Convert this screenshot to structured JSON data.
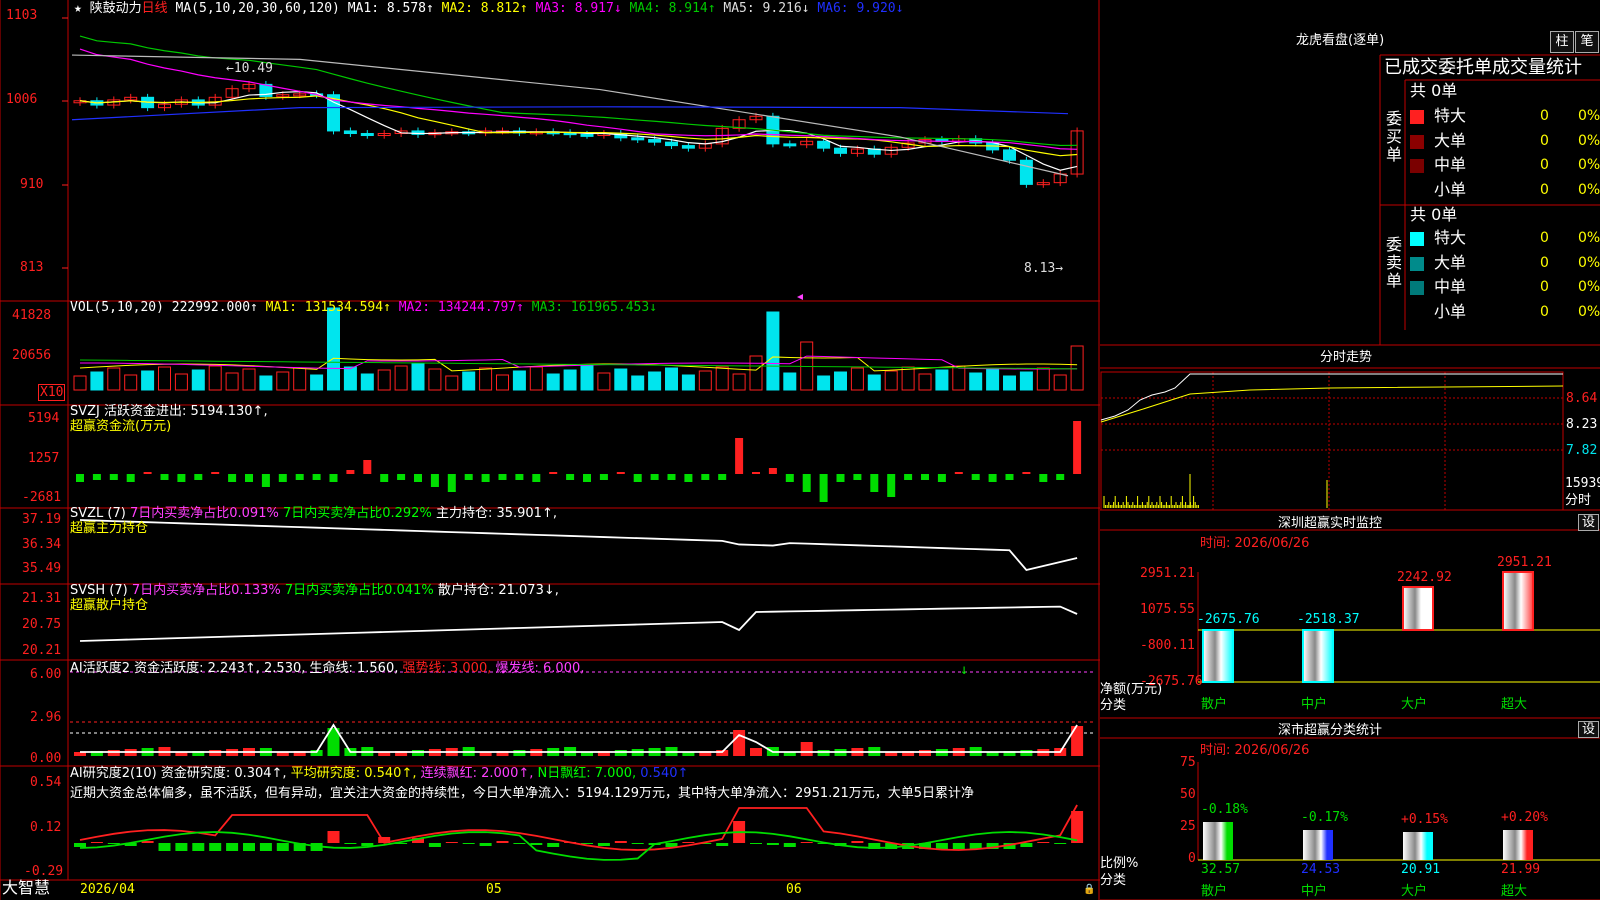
{
  "colors": {
    "up": "#ff2020",
    "down": "#00e5ee",
    "grid": "#c00000",
    "ma1": "#ffffff",
    "ma2": "#ffff00",
    "ma3": "#ff00ff",
    "ma4": "#00c800",
    "ma5": "#bbbbbb",
    "ma6": "#2030ff",
    "green": "#00dd00",
    "yellow": "#ffff00",
    "magenta": "#ff40ff",
    "cyan": "#00ffff"
  },
  "main": {
    "ystar": "★",
    "stock_name": "陕鼓动力",
    "period": "日线",
    "ma_label": "MA(5,10,20,30,60,120)",
    "ma1": "MA1: 8.578↑",
    "ma2": "MA2: 8.812↑",
    "ma3": "MA3: 8.917↓",
    "ma4": "MA4: 8.914↑",
    "ma5": "MA5: 9.216↓",
    "ma6": "MA6: 9.920↓",
    "yticks": [
      "1103",
      "1006",
      "910",
      "813"
    ],
    "high_mark": "←10.49",
    "low_mark": "8.13→"
  },
  "vol": {
    "label": "VOL(5,10,20)",
    "value": "222992.000↑",
    "ma1": "MA1: 131534.594↑",
    "ma2": "MA2: 134244.797↑",
    "ma3": "MA3: 161965.453↓",
    "yticks": [
      "41828",
      "20656"
    ],
    "unit": "X10"
  },
  "svzj": {
    "label": "SVZJ  活跃资金进出: 5194.130↑,",
    "sub": "超赢资金流(万元)",
    "yticks": [
      "5194",
      "1257",
      "-2681"
    ]
  },
  "svzl": {
    "label": "SVZL (7)",
    "t1": "7日内买卖净占比0.091%",
    "t2": "7日内买卖净占比0.292%",
    "t3": "主力持仓: 35.901↑,",
    "sub": "超赢主力持仓",
    "yticks": [
      "37.19",
      "36.34",
      "35.49"
    ]
  },
  "svsh": {
    "label": "SVSH (7)",
    "t1": "7日内买卖净占比0.133%",
    "t2": "7日内买卖净占比0.041%",
    "t3": "散户持仓: 21.073↓,",
    "sub": "超赢散户持仓",
    "yticks": [
      "21.31",
      "20.75",
      "20.21"
    ]
  },
  "ai2": {
    "label": "AI活跃度2 资金活跃度: 2.243↑, 2.530, 生命线: 1.560,",
    "t1": "强势线: 3.000,",
    "t2": "爆发线: 6.000,",
    "yticks": [
      "6.00",
      "2.96",
      "0.00"
    ]
  },
  "air": {
    "label": "AI研究度2(10) 资金研究度: 0.304↑,",
    "t1": "平均研究度: 0.540↑,",
    "t2": "连续飘红: 2.000↑,",
    "t3": "N日飘红: 7.000,",
    "t4": "0.540↑",
    "desc": "近期大资金总体偏多，虽不活跃，但有异动，宜关注大资金的持续性，今日大单净流入：5194.129万元，其中特大单净流入：2951.21万元，大单5日累计净",
    "yticks": [
      "0.54",
      "0.12",
      "-0.29"
    ]
  },
  "bottom": {
    "logo": "大智慧",
    "dates": [
      "2026/04",
      "05",
      "06"
    ]
  },
  "right": {
    "title": "龙虎看盘(逐单)",
    "btn1": "柱",
    "btn2": "笔",
    "header": "已成交委托单成交量统计",
    "buy": {
      "side": "委买单",
      "total": "共 0单",
      "rows": [
        {
          "name": "特大",
          "val": "0",
          "pct": "0%"
        },
        {
          "name": "大单",
          "val": "0",
          "pct": "0%"
        },
        {
          "name": "中单",
          "val": "0",
          "pct": "0%"
        },
        {
          "name": "小单",
          "val": "0",
          "pct": "0%"
        }
      ]
    },
    "sell": {
      "side": "委卖单",
      "total": "共 0单",
      "rows": [
        {
          "name": "特大",
          "val": "0",
          "pct": "0%"
        },
        {
          "name": "大单",
          "val": "0",
          "pct": "0%"
        },
        {
          "name": "中单",
          "val": "0",
          "pct": "0%"
        },
        {
          "name": "小单",
          "val": "0",
          "pct": "0%"
        }
      ]
    },
    "intraday": {
      "title": "分时走势",
      "yticks": [
        "8.64",
        "8.23",
        "7.82",
        "15939"
      ],
      "unit": "分时"
    },
    "monitor": {
      "title": "深圳超赢实时监控",
      "btn": "设",
      "time": "时间: 2026/06/26",
      "yticks": [
        "2951.21",
        "1075.55",
        "-800.11",
        "-2675.76"
      ],
      "ylabel": "净额(万元)",
      "xlabel": "分类",
      "cats": [
        "散户",
        "中户",
        "大户",
        "超大"
      ],
      "vals": [
        "-2675.76",
        "-2518.37",
        "2242.92",
        "2951.21"
      ]
    },
    "classify": {
      "title": "深市超赢分类统计",
      "btn": "设",
      "time": "时间: 2026/06/26",
      "yticks": [
        "75",
        "50",
        "25",
        "0"
      ],
      "ylabel": "比例%",
      "xlabel": "分类",
      "cats": [
        "散户",
        "中户",
        "大户",
        "超大"
      ],
      "pcts": [
        "-0.18%",
        "-0.17%",
        "+0.15%",
        "+0.20%"
      ],
      "vals": [
        "32.57",
        "24.53",
        "20.91",
        "21.99"
      ]
    }
  },
  "chart_data": {
    "type": "candlestick",
    "ma_colors": {
      "MA1": "#ffffff",
      "MA2": "#ffff00",
      "MA3": "#ff00ff",
      "MA4": "#00c800",
      "MA5": "#bbbbbb",
      "MA6": "#2030ff"
    },
    "ylim": [
      8.0,
      11.1
    ],
    "high": 10.49,
    "low": 8.13,
    "series": [
      {
        "name": "MA1",
        "values": [
          8.578
        ]
      },
      {
        "name": "MA2",
        "values": [
          8.812
        ]
      },
      {
        "name": "MA3",
        "values": [
          8.917
        ]
      },
      {
        "name": "MA4",
        "values": [
          8.914
        ]
      },
      {
        "name": "MA5",
        "values": [
          9.216
        ]
      },
      {
        "name": "MA6",
        "values": [
          9.92
        ]
      }
    ]
  }
}
